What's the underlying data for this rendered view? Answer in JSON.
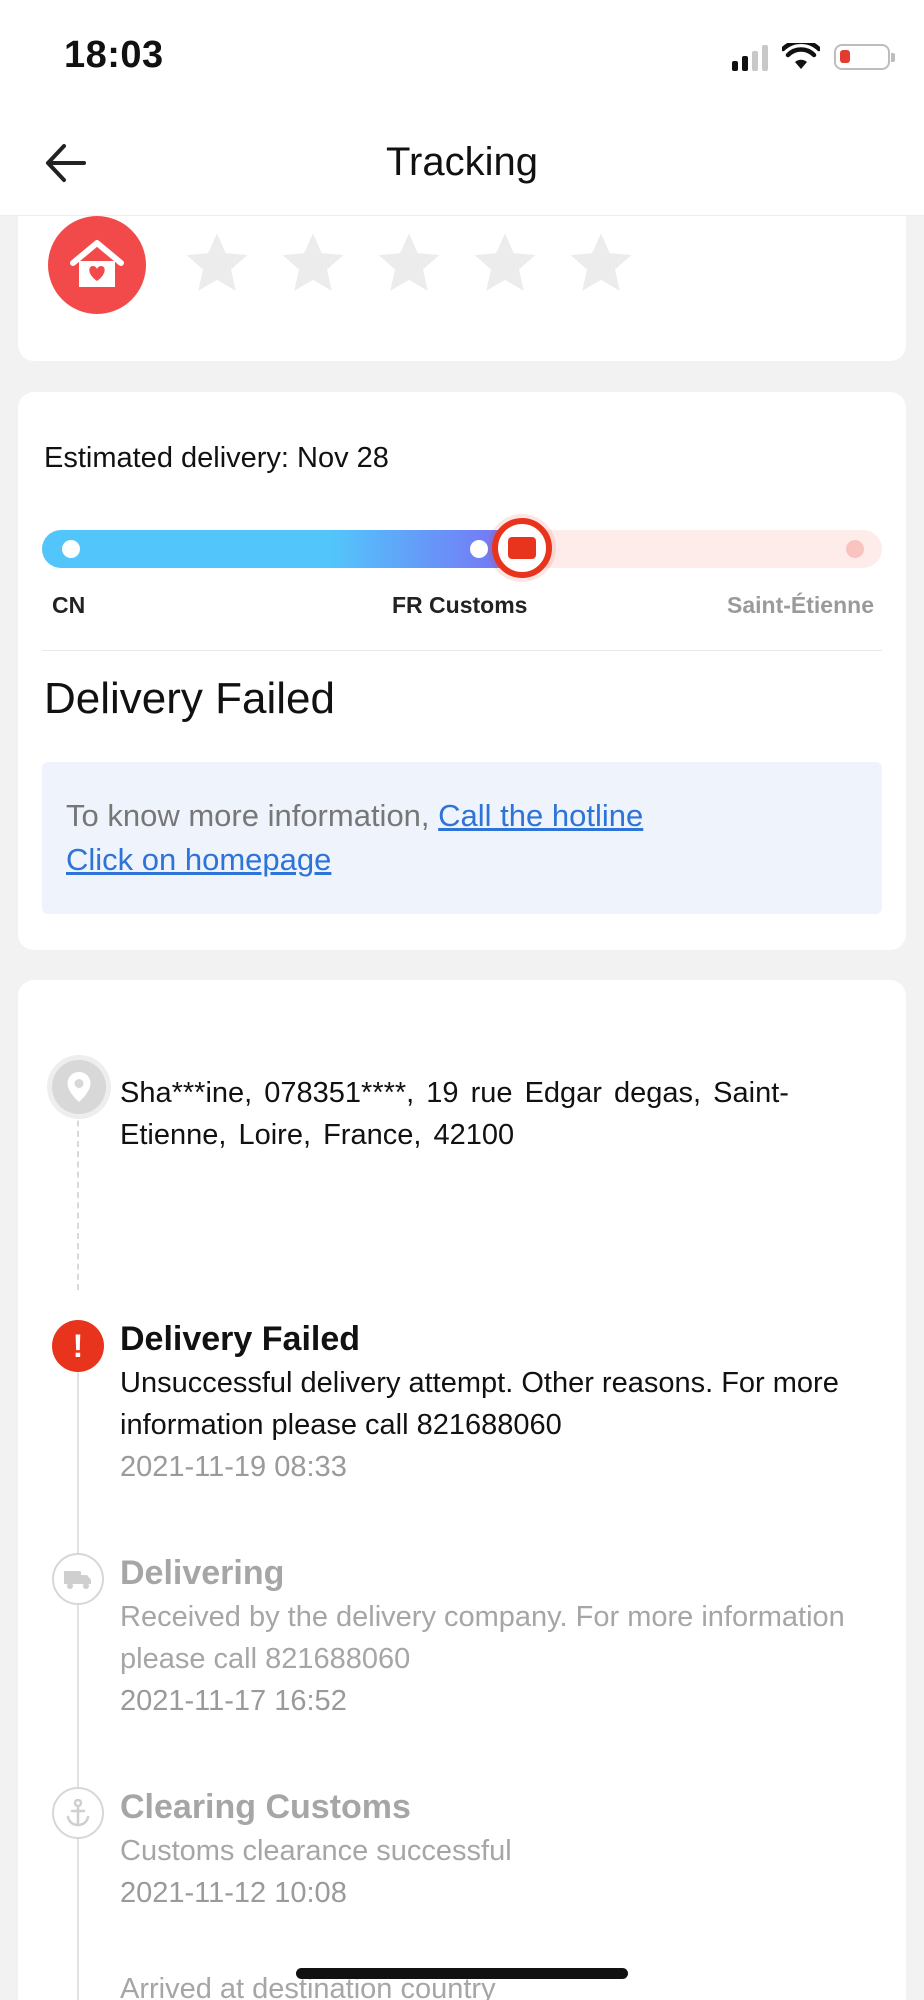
{
  "status_bar": {
    "time": "18:03",
    "icons": [
      "signal-icon",
      "wifi-icon",
      "battery-low-icon"
    ],
    "battery_color": "#e23b30"
  },
  "nav": {
    "title": "Tracking",
    "back_icon": "arrow-left-icon"
  },
  "rating": {
    "badge_icon": "home-heart-icon",
    "badge_color": "#f24a4a",
    "stars_total": 5,
    "stars_selected": 0
  },
  "progress": {
    "estimated_delivery": "Estimated delivery: Nov 28",
    "stops": [
      "CN",
      "FR Customs",
      "Saint-Étienne"
    ],
    "current_stop": "FR Customs",
    "status_heading": "Delivery Failed",
    "info_text": "To know more information,",
    "hotline_link": "Call the hotline",
    "homepage_link": "Click on homepage",
    "accent_color": "#e8341c",
    "progress_color": "#52c6fb"
  },
  "timeline": {
    "address": "Sha***ine,  078351****,  19 rue Edgar degas,  Saint-Etienne,  Loire,  France,  42100",
    "events": [
      {
        "title": "Delivery Failed",
        "description": "Unsuccessful delivery attempt. Other reasons. For more information please call 821688060",
        "time": "2021-11-19 08:33",
        "icon": "exclamation-icon",
        "state": "active"
      },
      {
        "title": "Delivering",
        "description": "Received by the delivery company. For more information please call 821688060",
        "time": "2021-11-17 16:52",
        "icon": "truck-icon",
        "state": "muted"
      },
      {
        "title": "Clearing Customs",
        "description": "Customs clearance successful",
        "time": "2021-11-12 10:08",
        "icon": "anchor-icon",
        "state": "muted"
      },
      {
        "title": "Arrived at destination country",
        "state": "muted"
      }
    ]
  }
}
